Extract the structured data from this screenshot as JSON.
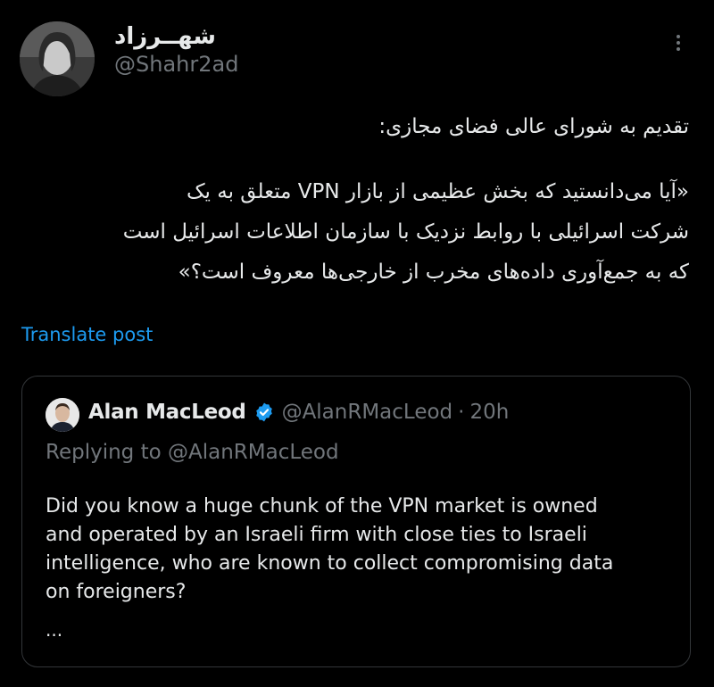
{
  "author": {
    "display_name": "شهــرزاد",
    "handle": "@Shahr2ad"
  },
  "post": {
    "paragraph1": "تقدیم به شورای عالی فضای مجازی:",
    "paragraph2_lines": [
      "«آیا می‌دانستید که بخش عظیمی از بازار VPN متعلق به یک",
      "شرکت اسرائیلی با روابط نزدیک با سازمان اطلاعات اسرائیل است",
      "که به جمع‌آوری داده‌های مخرب از خارجی‌ها معروف است؟»"
    ],
    "translate_label": "Translate post"
  },
  "quoted_post": {
    "name": "Alan MacLeod",
    "handle": "@AlanRMacLeod",
    "separator": "·",
    "time": "20h",
    "replying_to": "Replying to @AlanRMacLeod",
    "text_lines": [
      "Did you know a huge chunk of the VPN market is owned",
      "and operated by an Israeli firm with close ties to Israeli",
      "intelligence, who are known to collect compromising data",
      "on foreigners?"
    ],
    "truncation": "..."
  },
  "icons": {
    "more": "more-vertical-icon",
    "verified": "verified-badge-icon"
  },
  "colors": {
    "background": "#000000",
    "text": "#e7e9ea",
    "muted": "#71767b",
    "accent": "#1d9bf0",
    "border": "#333639"
  }
}
